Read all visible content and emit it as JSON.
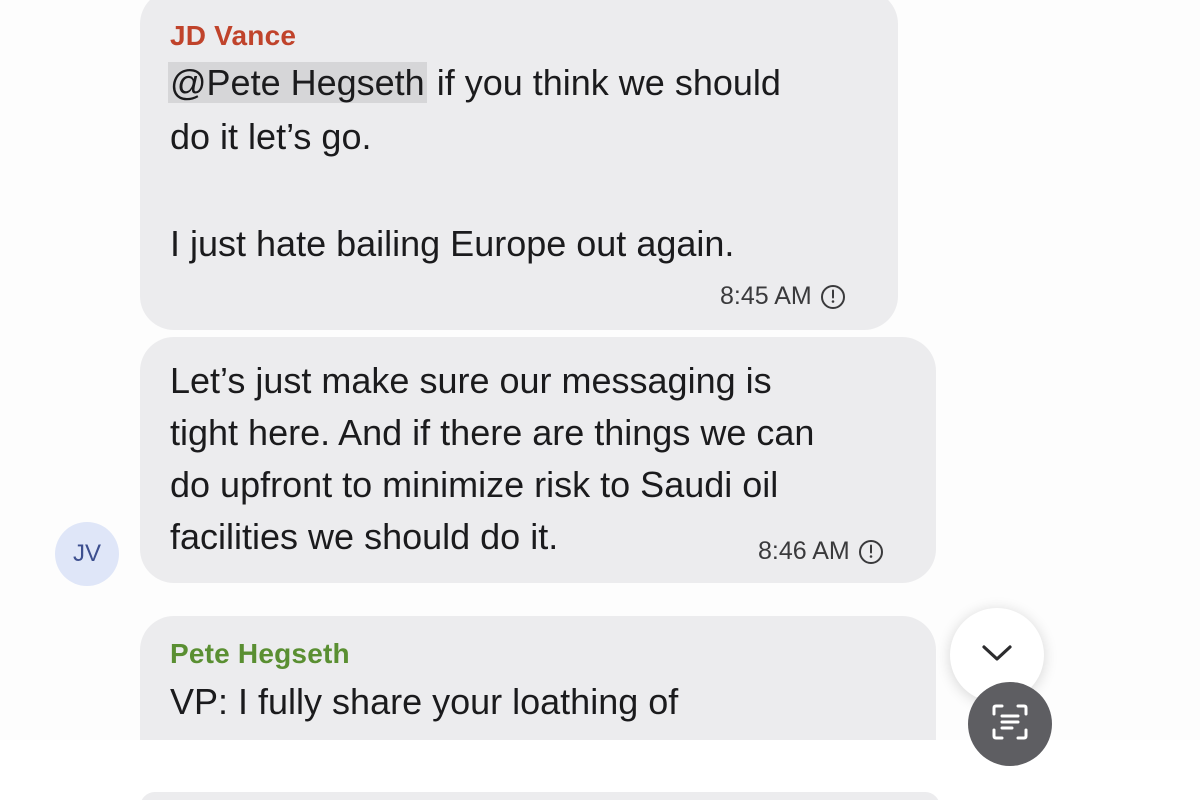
{
  "messages": [
    {
      "sender": "JD Vance",
      "sender_color": "#c0432b",
      "mention": "@Pete Hegseth",
      "line1_rest": " if you think we should",
      "line2": "do it let’s go.",
      "line3": "I just hate bailing Europe out again.",
      "time": "8:45 AM"
    },
    {
      "lines": [
        "Let’s just make sure our messaging is",
        "tight here. And if there are things we can",
        "do upfront to minimize risk to Saudi oil",
        "facilities we should do it."
      ],
      "time": "8:46 AM",
      "avatar_initials": "JV"
    },
    {
      "sender": "Pete Hegseth",
      "sender_color": "#5a8f32",
      "line1": "VP: I fully share your loathing of"
    }
  ],
  "icons": {
    "clock": "clock-icon",
    "scroll_down": "chevron-down-icon",
    "scan": "scan-text-icon"
  }
}
